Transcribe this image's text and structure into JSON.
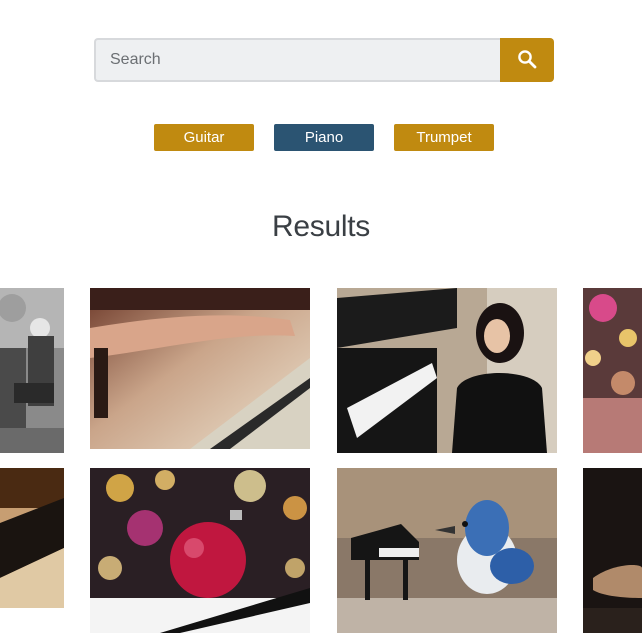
{
  "search": {
    "placeholder": "Search",
    "button_icon": "search-icon"
  },
  "filters": [
    {
      "label": "Guitar",
      "color": "#c08a10",
      "active": false
    },
    {
      "label": "Piano",
      "color": "#2b5472",
      "active": true
    },
    {
      "label": "Trumpet",
      "color": "#c08a10",
      "active": false
    }
  ],
  "results": {
    "title": "Results",
    "images": [
      {
        "description": "elderly-man-playing-piano-outdoors"
      },
      {
        "description": "hands-on-piano-keys"
      },
      {
        "description": "woman-seated-at-grand-piano"
      },
      {
        "description": "pink-bokeh-lights"
      },
      {
        "description": "piano-keys-closeup-warm"
      },
      {
        "description": "pink-ornament-on-piano-keys"
      },
      {
        "description": "blue-jay-with-toy-piano"
      },
      {
        "description": "dark-hand-closeup"
      }
    ]
  }
}
